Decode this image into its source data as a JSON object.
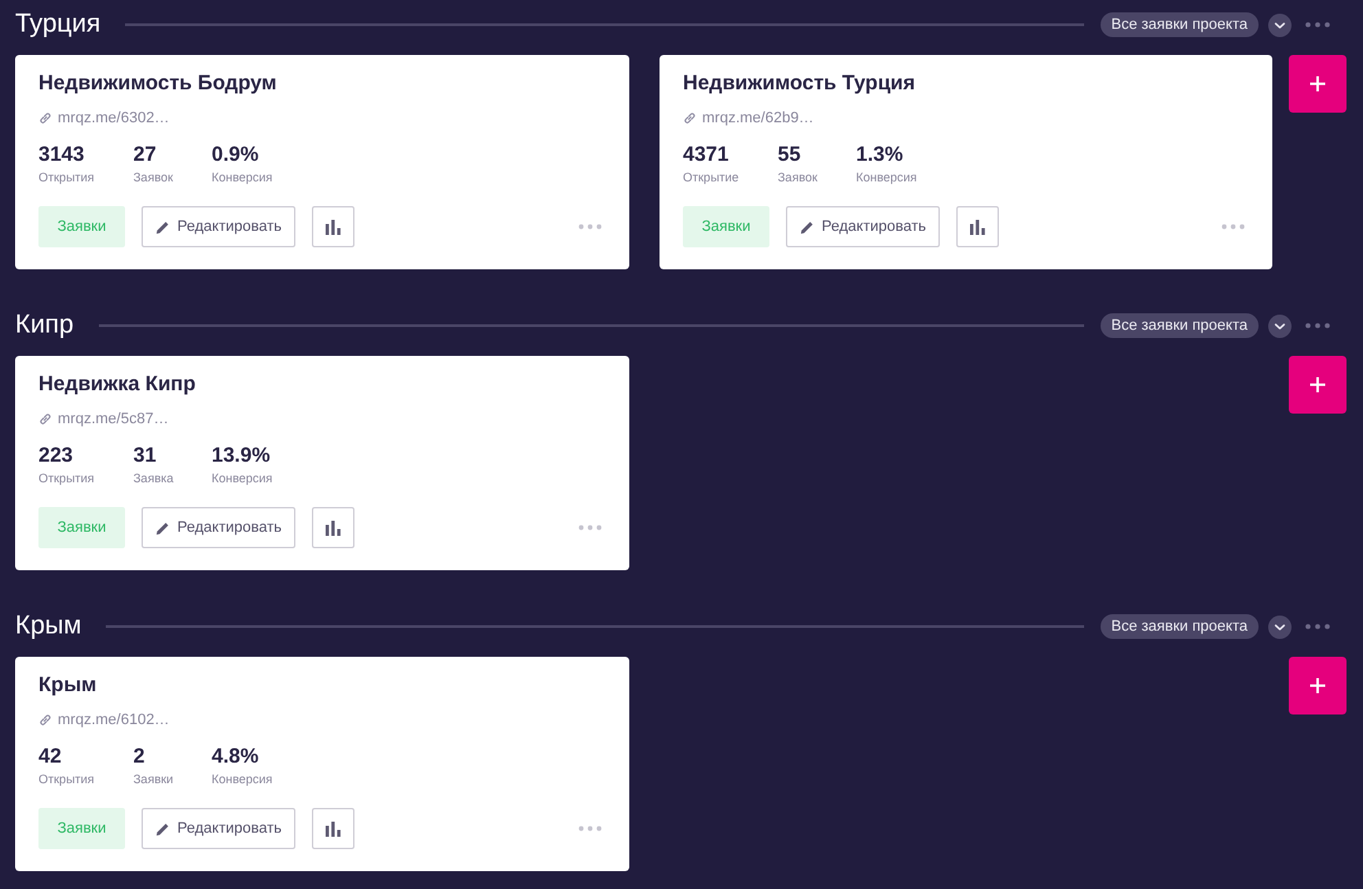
{
  "sections": [
    {
      "title": "Турция",
      "all_leads_button": "Все заявки проекта",
      "cards": [
        {
          "title": "Недвижимость Бодрум",
          "link": "mrqz.me/6302…",
          "stats": [
            {
              "value": "3143",
              "label": "Открытия"
            },
            {
              "value": "27",
              "label": "Заявок"
            },
            {
              "value": "0.9%",
              "label": "Конверсия"
            }
          ],
          "leads_button": "Заявки",
          "edit_button": "Редактировать"
        },
        {
          "title": "Недвижимость Турция",
          "link": "mrqz.me/62b9…",
          "stats": [
            {
              "value": "4371",
              "label": "Открытие"
            },
            {
              "value": "55",
              "label": "Заявок"
            },
            {
              "value": "1.3%",
              "label": "Конверсия"
            }
          ],
          "leads_button": "Заявки",
          "edit_button": "Редактировать"
        }
      ]
    },
    {
      "title": "Кипр",
      "all_leads_button": "Все заявки проекта",
      "cards": [
        {
          "title": "Недвижка Кипр",
          "link": "mrqz.me/5c87…",
          "stats": [
            {
              "value": "223",
              "label": "Открытия"
            },
            {
              "value": "31",
              "label": "Заявка"
            },
            {
              "value": "13.9%",
              "label": "Конверсия"
            }
          ],
          "leads_button": "Заявки",
          "edit_button": "Редактировать"
        }
      ]
    },
    {
      "title": "Крым",
      "all_leads_button": "Все заявки проекта",
      "cards": [
        {
          "title": "Крым",
          "link": "mrqz.me/6102…",
          "stats": [
            {
              "value": "42",
              "label": "Открытия"
            },
            {
              "value": "2",
              "label": "Заявки"
            },
            {
              "value": "4.8%",
              "label": "Конверсия"
            }
          ],
          "leads_button": "Заявки",
          "edit_button": "Редактировать"
        }
      ]
    }
  ]
}
